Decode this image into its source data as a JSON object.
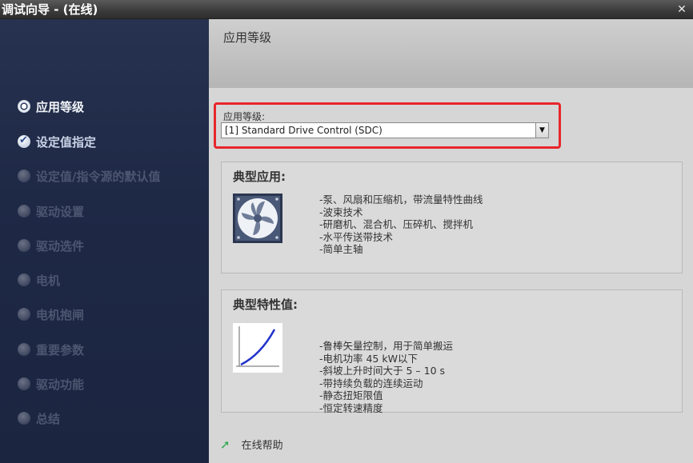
{
  "window": {
    "title": "调试向导 - (在线)",
    "close_label": "✕"
  },
  "sidebar": {
    "items": [
      {
        "label": "应用等级",
        "state": "active"
      },
      {
        "label": "设定值指定",
        "state": "done"
      },
      {
        "label": "设定值/指令源的默认值",
        "state": "disabled"
      },
      {
        "label": "驱动设置",
        "state": "disabled"
      },
      {
        "label": "驱动选件",
        "state": "disabled"
      },
      {
        "label": "电机",
        "state": "disabled"
      },
      {
        "label": "电机抱闸",
        "state": "disabled"
      },
      {
        "label": "重要参数",
        "state": "disabled"
      },
      {
        "label": "驱动功能",
        "state": "disabled"
      },
      {
        "label": "总结",
        "state": "disabled"
      }
    ]
  },
  "main": {
    "title": "应用等级",
    "app_class": {
      "label": "应用等级:",
      "selected": "[1] Standard Drive Control (SDC)"
    },
    "typical_apps": {
      "title": "典型应用:",
      "icon": "fan-icon",
      "lines": [
        "-泵、风扇和压缩机，带流量特性曲线",
        "-波束技术",
        "-研磨机、混合机、压碎机、搅拌机",
        "-水平传送带技术",
        "-简单主轴"
      ]
    },
    "typical_values": {
      "title": "典型特性值:",
      "icon": "curve-chart-icon",
      "lines": [
        "-鲁棒矢量控制，用于简单搬运",
        "-电机功率 45 kW以下",
        "-斜坡上升时间大于 5 – 10 s",
        "-带持续负载的连续运动",
        "-静态扭矩限值",
        "-恒定转速精度"
      ]
    },
    "help_label": "在线帮助"
  },
  "colors": {
    "highlight": "#e8262b",
    "help_arrow": "#2aa84a"
  }
}
